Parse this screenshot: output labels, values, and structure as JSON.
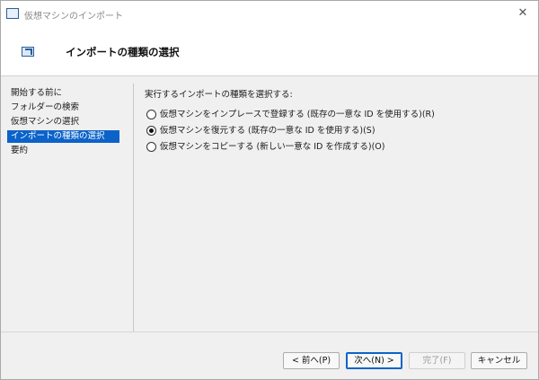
{
  "window": {
    "title": "仮想マシンのインポート",
    "close_glyph": "✕"
  },
  "header": {
    "heading": "インポートの種類の選択"
  },
  "sidebar": {
    "items": [
      {
        "label": "開始する前に",
        "active": false
      },
      {
        "label": "フォルダーの検索",
        "active": false
      },
      {
        "label": "仮想マシンの選択",
        "active": false
      },
      {
        "label": "インポートの種類の選択",
        "active": true
      },
      {
        "label": "要約",
        "active": false
      }
    ]
  },
  "main": {
    "prompt": "実行するインポートの種類を選択する:",
    "options": [
      {
        "label": "仮想マシンをインプレースで登録する (既存の一意な ID を使用する)(R)",
        "checked": false
      },
      {
        "label": "仮想マシンを復元する (既存の一意な ID を使用する)(S)",
        "checked": true
      },
      {
        "label": "仮想マシンをコピーする (新しい一意な ID を作成する)(O)",
        "checked": false
      }
    ]
  },
  "footer": {
    "prev_label": "< 前へ(P)",
    "next_label": "次へ(N) >",
    "finish_label": "完了(F)",
    "cancel_label": "キャンセル",
    "finish_enabled": false
  },
  "colors": {
    "accent": "#0b63c9",
    "background": "#f0f0f0",
    "header_bg": "#ffffff"
  },
  "icons": {
    "title": "import-vm-icon",
    "header": "import-wizard-icon",
    "close": "close-icon"
  }
}
